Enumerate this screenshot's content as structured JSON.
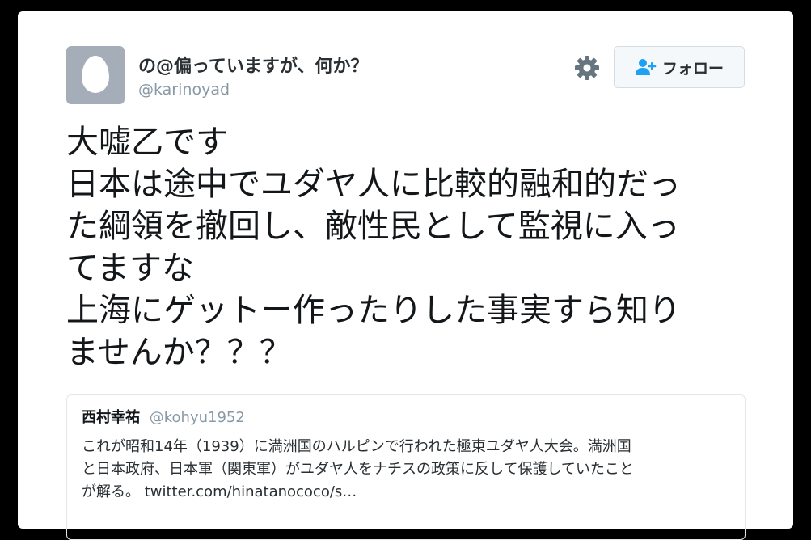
{
  "user": {
    "display_name": "の@偏っていますが、何か？",
    "handle": "@karinoyad",
    "avatar": "default-egg-avatar"
  },
  "actions": {
    "settings_icon": "gear-icon",
    "follow_icon": "add-user-icon",
    "follow_label": "フォロー"
  },
  "tweet": {
    "lines": [
      "大嘘乙です",
      "日本は途中でユダヤ人に比較的融和的だっ",
      "た綱領を撤回し、敵性民として監視に入っ",
      "てますな",
      "上海にゲットー作ったりした事実すら知り",
      "ませんか？？？"
    ]
  },
  "quoted_tweet": {
    "name": "西村幸祐",
    "handle": "@kohyu1952",
    "lines": [
      "これが昭和14年（1939）に満洲国のハルピンで行われた極東ユダヤ人大会。満洲国",
      "と日本政府、日本軍（関東軍）がユダヤ人をナチスの政策に反して保護していたこと",
      "が解る。 twitter.com/hinatanococo/s…"
    ]
  },
  "colors": {
    "background": "#000000",
    "card": "#ffffff",
    "text": "#14171a",
    "muted": "#8899a6",
    "accent": "#1da1f2",
    "icon": "#66757f"
  }
}
